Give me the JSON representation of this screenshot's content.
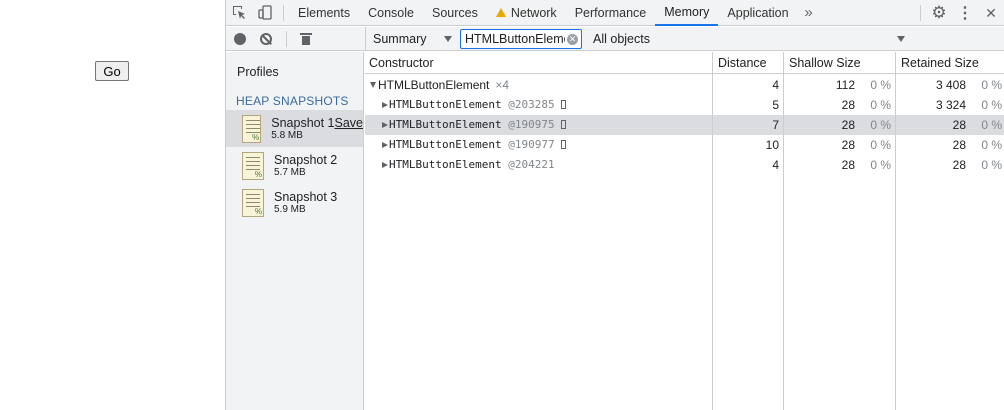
{
  "page": {
    "go_label": "Go"
  },
  "devtools": {
    "tabs": [
      {
        "label": "Elements"
      },
      {
        "label": "Console"
      },
      {
        "label": "Sources"
      },
      {
        "label": "Network"
      },
      {
        "label": "Performance"
      },
      {
        "label": "Memory"
      },
      {
        "label": "Application"
      }
    ],
    "active_tab": "Memory",
    "more_tabs": "»",
    "settings_icon": "⚙",
    "menu_icon": "⋮",
    "close_icon": "✕",
    "accent_color": "#1a73e8"
  },
  "toolbar": {
    "view": "Summary",
    "filter_value": "HTMLButtonElement",
    "objects": "All objects"
  },
  "sidebar": {
    "profiles_title": "Profiles",
    "heap_title": "HEAP SNAPSHOTS",
    "save_label": "Save",
    "snapshots": [
      {
        "name": "Snapshot 1",
        "size": "5.8 MB"
      },
      {
        "name": "Snapshot 2",
        "size": "5.7 MB"
      },
      {
        "name": "Snapshot 3",
        "size": "5.9 MB"
      }
    ]
  },
  "table": {
    "headers": {
      "constructor": "Constructor",
      "distance": "Distance",
      "shallow": "Shallow Size",
      "retained": "Retained Size"
    },
    "group": {
      "name": "HTMLButtonElement",
      "count": "×4",
      "distance": "4",
      "shallow": "112",
      "shallow_pct": "0 %",
      "retained": "3 408",
      "retained_pct": "0 %"
    },
    "rows": [
      {
        "name": "HTMLButtonElement",
        "id": "@203285",
        "distance": "5",
        "shallow": "28",
        "shallow_pct": "0 %",
        "retained": "3 324",
        "retained_pct": "0 %"
      },
      {
        "name": "HTMLButtonElement",
        "id": "@190975",
        "distance": "7",
        "shallow": "28",
        "shallow_pct": "0 %",
        "retained": "28",
        "retained_pct": "0 %"
      },
      {
        "name": "HTMLButtonElement",
        "id": "@190977",
        "distance": "10",
        "shallow": "28",
        "shallow_pct": "0 %",
        "retained": "28",
        "retained_pct": "0 %"
      },
      {
        "name": "HTMLButtonElement",
        "id": "@204221",
        "distance": "4",
        "shallow": "28",
        "shallow_pct": "0 %",
        "retained": "28",
        "retained_pct": "0 %"
      }
    ]
  }
}
